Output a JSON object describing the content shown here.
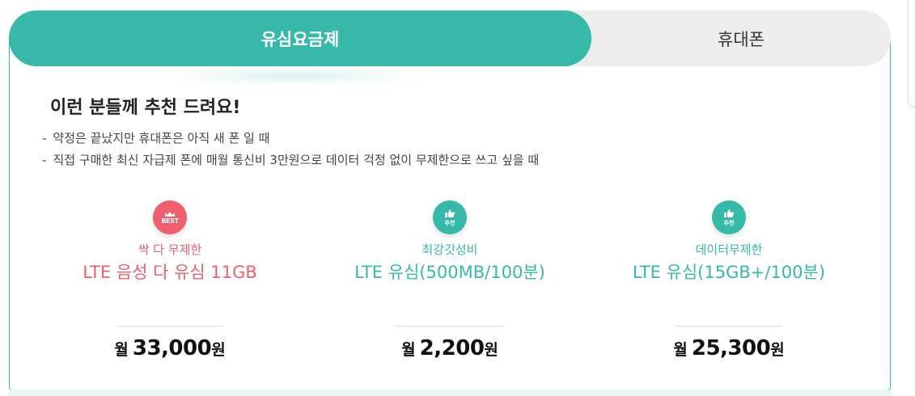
{
  "tabs": {
    "active_label": "유심요금제",
    "inactive_label": "휴대폰"
  },
  "recommend": {
    "heading": "이런 분들께 추천 드려요!",
    "bullets": [
      "약정은 끝났지만 휴대폰은 아직 새 폰 일 때",
      "직접 구매한 최신 자급제 폰에 매월 통신비 3만원으로 데이터 걱정 없이 무제한으로 쓰고 싶을 때"
    ],
    "bullet_mark": "-"
  },
  "plans": [
    {
      "badge_icon": "best-badge",
      "badge_text": "BEST",
      "category": "싹 다 무제한",
      "name": "LTE 음성 다 유심 11GB",
      "price_prefix": "월",
      "price": "33,000",
      "price_suffix": "원",
      "color": "#ef5f6d"
    },
    {
      "badge_icon": "thumbs-up-icon",
      "badge_text": "추천",
      "category": "최강갓성비",
      "name": "LTE 유심(500MB/100분)",
      "price_prefix": "월",
      "price": "2,200",
      "price_suffix": "원",
      "color": "#36b9a8"
    },
    {
      "badge_icon": "thumbs-up-icon",
      "badge_text": "추천",
      "category": "데이터무제한",
      "name": "LTE 유심(15GB+/100분)",
      "price_prefix": "월",
      "price": "25,300",
      "price_suffix": "원",
      "color": "#36b9a8"
    }
  ],
  "colors": {
    "accent": "#36b9a8",
    "best": "#ef5f6d",
    "inactive_tab": "#ededed"
  }
}
